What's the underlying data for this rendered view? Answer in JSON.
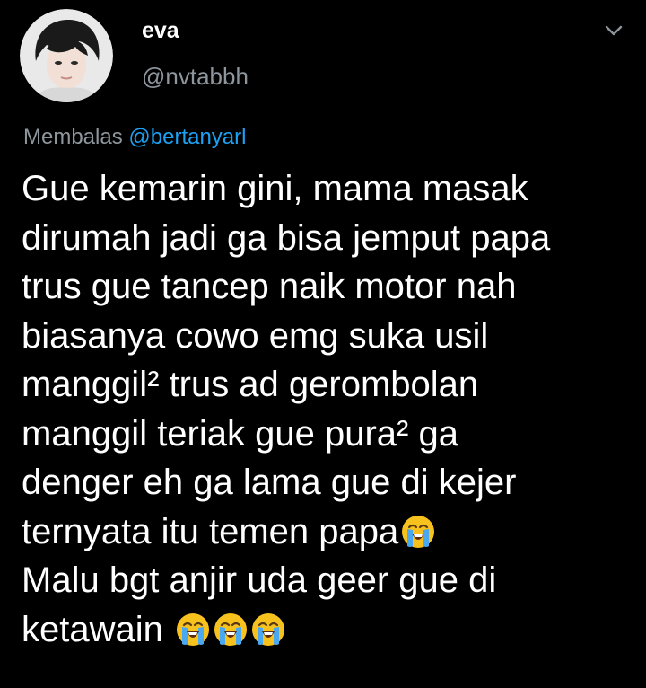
{
  "tweet": {
    "display_name": "eva",
    "handle": "@nvtabbh",
    "reply_prefix": "Membalas",
    "reply_to": "@bertanyarl",
    "lines": [
      "Gue kemarin gini, mama masak",
      "dirumah jadi ga bisa jemput papa",
      "trus gue tancep naik motor nah",
      "biasanya cowo emg suka usil",
      "manggil² trus ad gerombolan",
      "manggil teriak gue pura² ga",
      "denger eh ga lama gue di kejer",
      "ternyata itu temen papa",
      "Malu bgt anjir uda geer gue di",
      "ketawain"
    ]
  },
  "icons": {
    "avatar": "profile-photo",
    "menu": "chevron-down-icon",
    "emoji": "loudly-crying-face-emoji"
  },
  "colors": {
    "background": "#000000",
    "text": "#ffffff",
    "secondary_text": "#8e969d",
    "mention": "#1da1f2"
  }
}
